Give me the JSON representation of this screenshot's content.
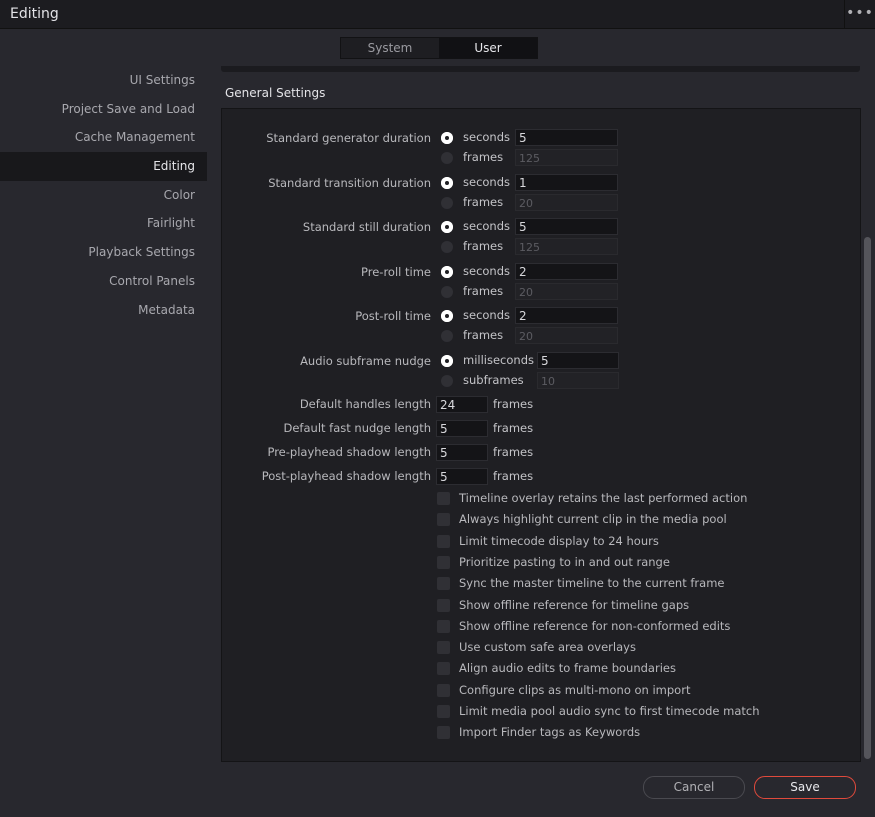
{
  "window": {
    "title": "Editing",
    "menu_icon": "more-horizontal-icon"
  },
  "tabs": [
    {
      "label": "System",
      "active": false
    },
    {
      "label": "User",
      "active": true
    }
  ],
  "sidebar": {
    "items": [
      {
        "label": "UI Settings",
        "active": false
      },
      {
        "label": "Project Save and Load",
        "active": false
      },
      {
        "label": "Cache Management",
        "active": false
      },
      {
        "label": "Editing",
        "active": true
      },
      {
        "label": "Color",
        "active": false
      },
      {
        "label": "Fairlight",
        "active": false
      },
      {
        "label": "Playback Settings",
        "active": false
      },
      {
        "label": "Control Panels",
        "active": false
      },
      {
        "label": "Metadata",
        "active": false
      }
    ]
  },
  "section": {
    "title": "General Settings"
  },
  "durations": [
    {
      "label": "Standard generator duration",
      "opt1": "seconds",
      "val1": "5",
      "opt2": "frames",
      "val2": "125",
      "selected": 1
    },
    {
      "label": "Standard transition duration",
      "opt1": "seconds",
      "val1": "1",
      "opt2": "frames",
      "val2": "20",
      "selected": 1
    },
    {
      "label": "Standard still duration",
      "opt1": "seconds",
      "val1": "5",
      "opt2": "frames",
      "val2": "125",
      "selected": 1
    },
    {
      "label": "Pre-roll time",
      "opt1": "seconds",
      "val1": "2",
      "opt2": "frames",
      "val2": "20",
      "selected": 1
    },
    {
      "label": "Post-roll time",
      "opt1": "seconds",
      "val1": "2",
      "opt2": "frames",
      "val2": "20",
      "selected": 1
    },
    {
      "label": "Audio subframe nudge",
      "opt1": "milliseconds",
      "val1": "5",
      "opt2": "subframes",
      "val2": "10",
      "selected": 1
    }
  ],
  "lengths": [
    {
      "label": "Default handles length",
      "value": "24",
      "unit": "frames"
    },
    {
      "label": "Default fast nudge length",
      "value": "5",
      "unit": "frames"
    },
    {
      "label": "Pre-playhead shadow length",
      "value": "5",
      "unit": "frames"
    },
    {
      "label": "Post-playhead shadow length",
      "value": "5",
      "unit": "frames"
    }
  ],
  "checkboxes": [
    {
      "label": "Timeline overlay retains the last performed action",
      "checked": false
    },
    {
      "label": "Always highlight current clip in the media pool",
      "checked": false
    },
    {
      "label": "Limit timecode display to 24 hours",
      "checked": false
    },
    {
      "label": "Prioritize pasting to in and out range",
      "checked": false
    },
    {
      "label": "Sync the master timeline to the current frame",
      "checked": false
    },
    {
      "label": "Show offline reference for timeline gaps",
      "checked": false
    },
    {
      "label": "Show offline reference for non-conformed edits",
      "checked": false
    },
    {
      "label": "Use custom safe area overlays",
      "checked": false
    },
    {
      "label": "Align audio edits to frame boundaries",
      "checked": false
    },
    {
      "label": "Configure clips as multi-mono on import",
      "checked": false
    },
    {
      "label": "Limit media pool audio sync to first timecode match",
      "checked": false
    },
    {
      "label": "Import Finder tags as Keywords",
      "checked": false
    }
  ],
  "footer": {
    "cancel_label": "Cancel",
    "save_label": "Save"
  },
  "colors": {
    "accent_save_border": "#e04a3c",
    "background": "#28282e",
    "panel": "#1f1f23"
  }
}
